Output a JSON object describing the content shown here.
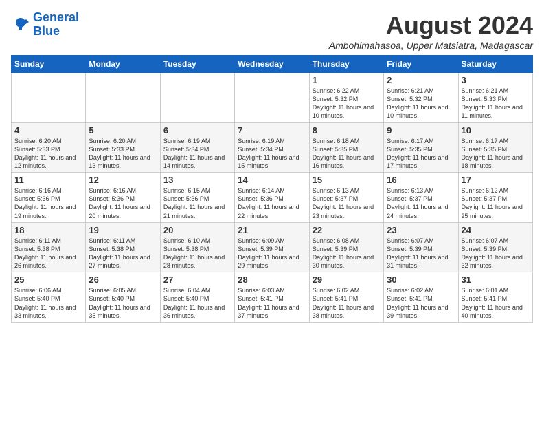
{
  "logo": {
    "text_general": "General",
    "text_blue": "Blue"
  },
  "header": {
    "month_year": "August 2024",
    "location": "Ambohimahasoa, Upper Matsiatra, Madagascar"
  },
  "days_of_week": [
    "Sunday",
    "Monday",
    "Tuesday",
    "Wednesday",
    "Thursday",
    "Friday",
    "Saturday"
  ],
  "weeks": [
    [
      {
        "day": "",
        "info": ""
      },
      {
        "day": "",
        "info": ""
      },
      {
        "day": "",
        "info": ""
      },
      {
        "day": "",
        "info": ""
      },
      {
        "day": "1",
        "info": "Sunrise: 6:22 AM\nSunset: 5:32 PM\nDaylight: 11 hours\nand 10 minutes."
      },
      {
        "day": "2",
        "info": "Sunrise: 6:21 AM\nSunset: 5:32 PM\nDaylight: 11 hours\nand 10 minutes."
      },
      {
        "day": "3",
        "info": "Sunrise: 6:21 AM\nSunset: 5:33 PM\nDaylight: 11 hours\nand 11 minutes."
      }
    ],
    [
      {
        "day": "4",
        "info": "Sunrise: 6:20 AM\nSunset: 5:33 PM\nDaylight: 11 hours\nand 12 minutes."
      },
      {
        "day": "5",
        "info": "Sunrise: 6:20 AM\nSunset: 5:33 PM\nDaylight: 11 hours\nand 13 minutes."
      },
      {
        "day": "6",
        "info": "Sunrise: 6:19 AM\nSunset: 5:34 PM\nDaylight: 11 hours\nand 14 minutes."
      },
      {
        "day": "7",
        "info": "Sunrise: 6:19 AM\nSunset: 5:34 PM\nDaylight: 11 hours\nand 15 minutes."
      },
      {
        "day": "8",
        "info": "Sunrise: 6:18 AM\nSunset: 5:35 PM\nDaylight: 11 hours\nand 16 minutes."
      },
      {
        "day": "9",
        "info": "Sunrise: 6:17 AM\nSunset: 5:35 PM\nDaylight: 11 hours\nand 17 minutes."
      },
      {
        "day": "10",
        "info": "Sunrise: 6:17 AM\nSunset: 5:35 PM\nDaylight: 11 hours\nand 18 minutes."
      }
    ],
    [
      {
        "day": "11",
        "info": "Sunrise: 6:16 AM\nSunset: 5:36 PM\nDaylight: 11 hours\nand 19 minutes."
      },
      {
        "day": "12",
        "info": "Sunrise: 6:16 AM\nSunset: 5:36 PM\nDaylight: 11 hours\nand 20 minutes."
      },
      {
        "day": "13",
        "info": "Sunrise: 6:15 AM\nSunset: 5:36 PM\nDaylight: 11 hours\nand 21 minutes."
      },
      {
        "day": "14",
        "info": "Sunrise: 6:14 AM\nSunset: 5:36 PM\nDaylight: 11 hours\nand 22 minutes."
      },
      {
        "day": "15",
        "info": "Sunrise: 6:13 AM\nSunset: 5:37 PM\nDaylight: 11 hours\nand 23 minutes."
      },
      {
        "day": "16",
        "info": "Sunrise: 6:13 AM\nSunset: 5:37 PM\nDaylight: 11 hours\nand 24 minutes."
      },
      {
        "day": "17",
        "info": "Sunrise: 6:12 AM\nSunset: 5:37 PM\nDaylight: 11 hours\nand 25 minutes."
      }
    ],
    [
      {
        "day": "18",
        "info": "Sunrise: 6:11 AM\nSunset: 5:38 PM\nDaylight: 11 hours\nand 26 minutes."
      },
      {
        "day": "19",
        "info": "Sunrise: 6:11 AM\nSunset: 5:38 PM\nDaylight: 11 hours\nand 27 minutes."
      },
      {
        "day": "20",
        "info": "Sunrise: 6:10 AM\nSunset: 5:38 PM\nDaylight: 11 hours\nand 28 minutes."
      },
      {
        "day": "21",
        "info": "Sunrise: 6:09 AM\nSunset: 5:39 PM\nDaylight: 11 hours\nand 29 minutes."
      },
      {
        "day": "22",
        "info": "Sunrise: 6:08 AM\nSunset: 5:39 PM\nDaylight: 11 hours\nand 30 minutes."
      },
      {
        "day": "23",
        "info": "Sunrise: 6:07 AM\nSunset: 5:39 PM\nDaylight: 11 hours\nand 31 minutes."
      },
      {
        "day": "24",
        "info": "Sunrise: 6:07 AM\nSunset: 5:39 PM\nDaylight: 11 hours\nand 32 minutes."
      }
    ],
    [
      {
        "day": "25",
        "info": "Sunrise: 6:06 AM\nSunset: 5:40 PM\nDaylight: 11 hours\nand 33 minutes."
      },
      {
        "day": "26",
        "info": "Sunrise: 6:05 AM\nSunset: 5:40 PM\nDaylight: 11 hours\nand 35 minutes."
      },
      {
        "day": "27",
        "info": "Sunrise: 6:04 AM\nSunset: 5:40 PM\nDaylight: 11 hours\nand 36 minutes."
      },
      {
        "day": "28",
        "info": "Sunrise: 6:03 AM\nSunset: 5:41 PM\nDaylight: 11 hours\nand 37 minutes."
      },
      {
        "day": "29",
        "info": "Sunrise: 6:02 AM\nSunset: 5:41 PM\nDaylight: 11 hours\nand 38 minutes."
      },
      {
        "day": "30",
        "info": "Sunrise: 6:02 AM\nSunset: 5:41 PM\nDaylight: 11 hours\nand 39 minutes."
      },
      {
        "day": "31",
        "info": "Sunrise: 6:01 AM\nSunset: 5:41 PM\nDaylight: 11 hours\nand 40 minutes."
      }
    ]
  ]
}
